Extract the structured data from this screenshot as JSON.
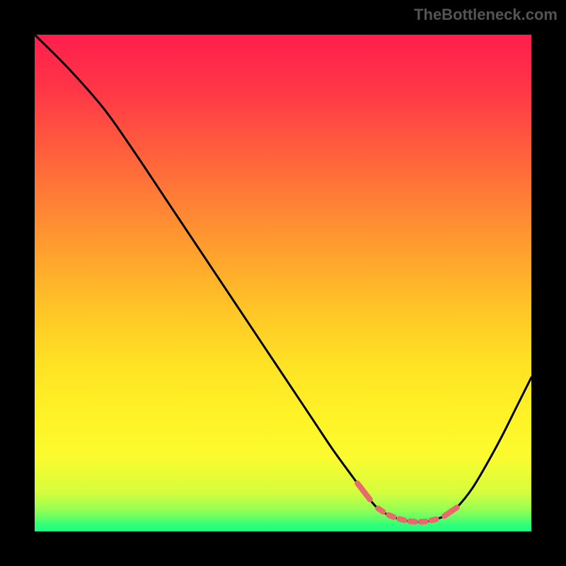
{
  "attribution": "TheBottleneck.com",
  "chart_data": {
    "type": "line",
    "title": "",
    "xlabel": "",
    "ylabel": "",
    "xlim": [
      0,
      100
    ],
    "ylim": [
      0,
      100
    ],
    "x": [
      0,
      7,
      14,
      20,
      26,
      32,
      38,
      44,
      50,
      56,
      60,
      64,
      67,
      69,
      71,
      73,
      75,
      77,
      79,
      81,
      83,
      85,
      88,
      91,
      94,
      97,
      100
    ],
    "y": [
      100,
      93,
      85,
      76.5,
      67.5,
      58.5,
      49.5,
      40.5,
      31.5,
      22.5,
      16.5,
      11,
      7,
      4.7,
      3.4,
      2.6,
      2.1,
      1.9,
      2.0,
      2.5,
      3.3,
      4.8,
      8.5,
      13.5,
      19,
      25,
      31
    ],
    "trough_x": [
      65,
      85
    ],
    "marker_color": "#e86a6a",
    "background_gradient_stops": [
      {
        "offset": 0.0,
        "color": "#ff1e4c"
      },
      {
        "offset": 0.11,
        "color": "#ff3647"
      },
      {
        "offset": 0.22,
        "color": "#ff5a3e"
      },
      {
        "offset": 0.33,
        "color": "#ff7e36"
      },
      {
        "offset": 0.44,
        "color": "#ffa12e"
      },
      {
        "offset": 0.55,
        "color": "#ffc427"
      },
      {
        "offset": 0.66,
        "color": "#ffe125"
      },
      {
        "offset": 0.77,
        "color": "#fff327"
      },
      {
        "offset": 0.85,
        "color": "#fbfb2f"
      },
      {
        "offset": 0.92,
        "color": "#d7fd3c"
      },
      {
        "offset": 0.955,
        "color": "#9afe52"
      },
      {
        "offset": 0.975,
        "color": "#5dfe68"
      },
      {
        "offset": 0.985,
        "color": "#35fe77"
      },
      {
        "offset": 1.0,
        "color": "#1cff80"
      }
    ]
  }
}
